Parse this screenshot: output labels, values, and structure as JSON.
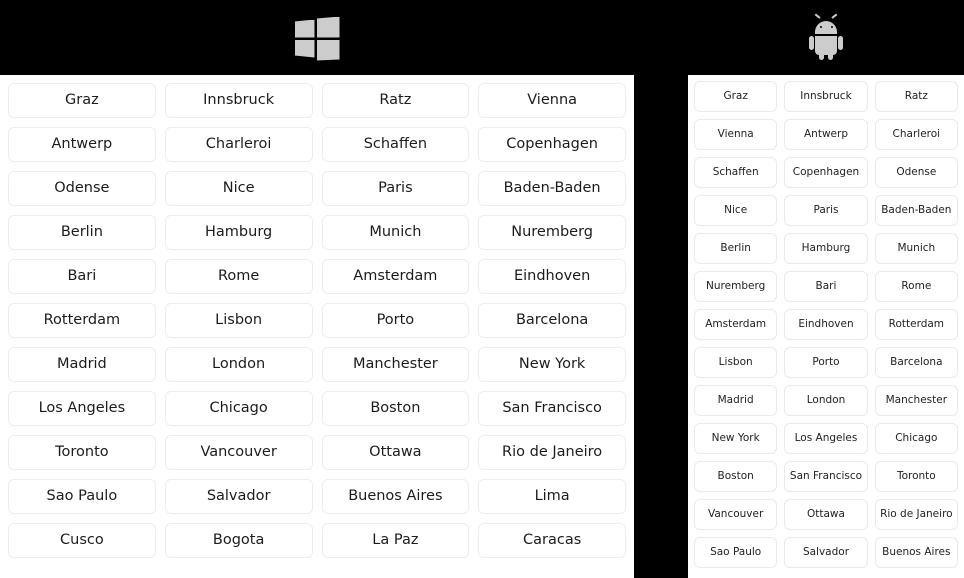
{
  "page": {
    "background_color": "#000000",
    "panel_background": "#ffffff",
    "cell_border_color": "#ececed",
    "logo_color": "#cccccc",
    "text_color": "#1c1c1c"
  },
  "header": {
    "windows": {
      "icon": "windows-logo-icon",
      "platform": "Windows"
    },
    "android": {
      "icon": "android-robot-icon",
      "platform": "Android"
    }
  },
  "windows_panel": {
    "columns": 4,
    "cells": [
      "Graz",
      "Innsbruck",
      "Ratz",
      "Vienna",
      "Antwerp",
      "Charleroi",
      "Schaffen",
      "Copenhagen",
      "Odense",
      "Nice",
      "Paris",
      "Baden-Baden",
      "Berlin",
      "Hamburg",
      "Munich",
      "Nuremberg",
      "Bari",
      "Rome",
      "Amsterdam",
      "Eindhoven",
      "Rotterdam",
      "Lisbon",
      "Porto",
      "Barcelona",
      "Madrid",
      "London",
      "Manchester",
      "New York",
      "Los Angeles",
      "Chicago",
      "Boston",
      "San Francisco",
      "Toronto",
      "Vancouver",
      "Ottawa",
      "Rio de Janeiro",
      "Sao Paulo",
      "Salvador",
      "Buenos Aires",
      "Lima",
      "Cusco",
      "Bogota",
      "La Paz",
      "Caracas"
    ]
  },
  "android_panel": {
    "columns": 3,
    "cells": [
      "Graz",
      "Innsbruck",
      "Ratz",
      "Vienna",
      "Antwerp",
      "Charleroi",
      "Schaffen",
      "Copenhagen",
      "Odense",
      "Nice",
      "Paris",
      "Baden-Baden",
      "Berlin",
      "Hamburg",
      "Munich",
      "Nuremberg",
      "Bari",
      "Rome",
      "Amsterdam",
      "Eindhoven",
      "Rotterdam",
      "Lisbon",
      "Porto",
      "Barcelona",
      "Madrid",
      "London",
      "Manchester",
      "New York",
      "Los Angeles",
      "Chicago",
      "Boston",
      "San Francisco",
      "Toronto",
      "Vancouver",
      "Ottawa",
      "Rio de Janeiro",
      "Sao Paulo",
      "Salvador",
      "Buenos Aires"
    ]
  }
}
